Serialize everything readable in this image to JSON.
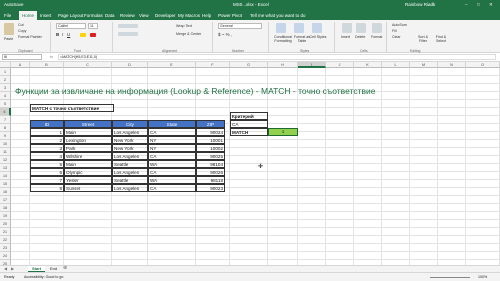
{
  "window": {
    "autosave": "AutoSave",
    "title": "MS0...xlsx - Excel",
    "user": "Rainbow Riadk"
  },
  "tabs": [
    "File",
    "Home",
    "Insert",
    "Page Layout",
    "Formulas",
    "Data",
    "Review",
    "View",
    "Developer",
    "My Macros",
    "Help",
    "Power Pivot",
    "Tell me what you want to do"
  ],
  "ribbon": {
    "clipboard": {
      "paste": "Paste",
      "cut": "Cut",
      "copy": "Copy",
      "format_painter": "Format Painter",
      "label": "Clipboard"
    },
    "font": {
      "name": "Calibri",
      "size": "11",
      "label": "Font"
    },
    "alignment": {
      "wrap": "Wrap Text",
      "merge": "Merge & Center",
      "label": "Alignment"
    },
    "number": {
      "format": "General",
      "label": "Number"
    },
    "styles": {
      "conditional": "Conditional Formatting",
      "format_table": "Format as Table",
      "cell_styles": "Cell Styles",
      "label": "Styles"
    },
    "cells": {
      "insert": "Insert",
      "delete": "Delete",
      "format": "Format",
      "label": "Cells"
    },
    "editing": {
      "autosum": "AutoSum",
      "fill": "Fill",
      "clear": "Clear",
      "sort": "Sort & Filter",
      "find": "Find & Select",
      "label": "Editing"
    }
  },
  "formula_bar": {
    "name_box": "I6",
    "formula": "=MATCH(H5,E3:E11,0)"
  },
  "columns": [
    "A",
    "B",
    "C",
    "D",
    "E",
    "F",
    "G",
    "H",
    "I",
    "J",
    "K",
    "L",
    "M",
    "N",
    "O"
  ],
  "rows": [
    "1",
    "2",
    "3",
    "4",
    "5",
    "6",
    "7",
    "8",
    "9",
    "10",
    "11",
    "12",
    "13",
    "14",
    "15",
    "16",
    "17",
    "18",
    "19",
    "20",
    "21",
    "22",
    "23",
    "24",
    "25"
  ],
  "sheet": {
    "heading": "Функции за извличане на информация (Lookup & Reference) - MATCH - точно съответствие",
    "subtitle": "MATCH с точно съответствие",
    "table_headers": [
      "ID",
      "Street",
      "City",
      "State",
      "ZIP"
    ],
    "table_rows": [
      [
        "1",
        "Main",
        "Los Angeles",
        "CA",
        "90024"
      ],
      [
        "2",
        "Lexington",
        "New York",
        "NY",
        "10001"
      ],
      [
        "3",
        "Park",
        "New York",
        "NY",
        "10002"
      ],
      [
        "4",
        "Wilshire",
        "Los Angeles",
        "CA",
        "90025"
      ],
      [
        "5",
        "Main",
        "Seattle",
        "WA",
        "98104"
      ],
      [
        "6",
        "Olympic",
        "Los Angeles",
        "CA",
        "90026"
      ],
      [
        "7",
        "Yesler",
        "Seattle",
        "WA",
        "98118"
      ],
      [
        "8",
        "Sunset",
        "Los Angeles",
        "CA",
        "90023"
      ]
    ],
    "criteria_label": "Критерий",
    "criteria_value": "CA",
    "match_label": "MATCH",
    "match_result": "1"
  },
  "sheet_tabs": [
    "Start",
    "End"
  ],
  "status": {
    "left": "Ready",
    "accessibility": "Accessibility: Good to go",
    "zoom": "100%"
  },
  "colors": {
    "excel_green": "#217346",
    "header_blue": "#4472c4",
    "result_green": "#92d050"
  }
}
